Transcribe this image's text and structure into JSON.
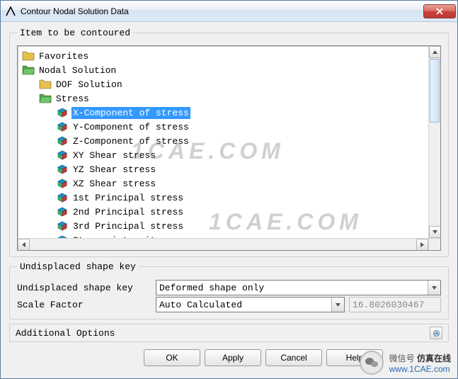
{
  "window": {
    "title": "Contour Nodal Solution Data"
  },
  "group1": {
    "legend": "Item to be contoured"
  },
  "tree": {
    "items": [
      {
        "label": "Favorites",
        "depth": 0,
        "icon": "folder-fav",
        "selected": false
      },
      {
        "label": "Nodal Solution",
        "depth": 0,
        "icon": "folder-open",
        "selected": false
      },
      {
        "label": "DOF Solution",
        "depth": 1,
        "icon": "folder",
        "selected": false
      },
      {
        "label": "Stress",
        "depth": 1,
        "icon": "folder-open",
        "selected": false
      },
      {
        "label": "X-Component of stress",
        "depth": 2,
        "icon": "cube",
        "selected": true
      },
      {
        "label": "Y-Component of stress",
        "depth": 2,
        "icon": "cube",
        "selected": false
      },
      {
        "label": "Z-Component of stress",
        "depth": 2,
        "icon": "cube",
        "selected": false
      },
      {
        "label": "XY Shear stress",
        "depth": 2,
        "icon": "cube",
        "selected": false
      },
      {
        "label": "YZ Shear stress",
        "depth": 2,
        "icon": "cube",
        "selected": false
      },
      {
        "label": "XZ Shear stress",
        "depth": 2,
        "icon": "cube",
        "selected": false
      },
      {
        "label": "1st Principal stress",
        "depth": 2,
        "icon": "cube",
        "selected": false
      },
      {
        "label": "2nd Principal stress",
        "depth": 2,
        "icon": "cube",
        "selected": false
      },
      {
        "label": "3rd Principal stress",
        "depth": 2,
        "icon": "cube",
        "selected": false
      },
      {
        "label": "Stress intensity",
        "depth": 2,
        "icon": "cube",
        "selected": false
      }
    ]
  },
  "group2": {
    "legend": "Undisplaced shape key",
    "row1_label": "Undisplaced shape key",
    "row1_value": "Deformed shape only",
    "row2_label": "Scale Factor",
    "row2_value": "Auto Calculated",
    "scale_readonly": "16.8026030467"
  },
  "additional": {
    "label": "Additional Options"
  },
  "buttons": {
    "ok": "OK",
    "apply": "Apply",
    "cancel": "Cancel",
    "help": "Help"
  },
  "watermarks": {
    "wm1": "1CAE.COM",
    "wm2": "1CAE.COM"
  },
  "footer": {
    "wechat_label": "微信号",
    "brand": "仿真在线",
    "url": "www.1CAE.com"
  }
}
